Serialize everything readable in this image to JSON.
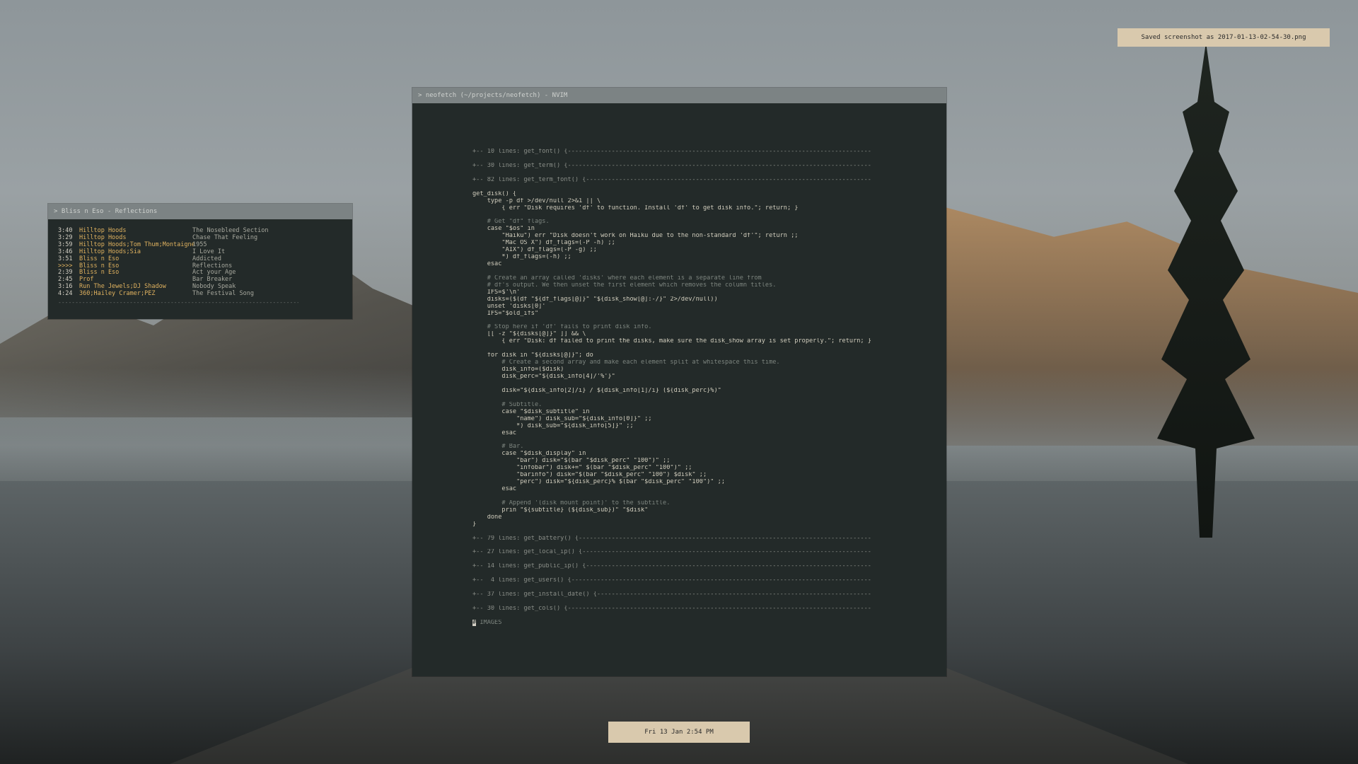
{
  "notification": {
    "text": "Saved screenshot as 2017-01-13-02-54-30.png"
  },
  "clock": {
    "text": "Fri 13 Jan  2:54 PM"
  },
  "music": {
    "title": "> Bliss n Eso - Reflections",
    "tracks": [
      {
        "time": "3:40",
        "artist": "Hilltop Hoods",
        "song": "The Nosebleed Section"
      },
      {
        "time": "3:29",
        "artist": "Hilltop Hoods",
        "song": "Chase That Feeling"
      },
      {
        "time": "3:59",
        "artist": "Hilltop Hoods;Tom Thum;Montaigne",
        "song": "1955"
      },
      {
        "time": "3:46",
        "artist": "Hilltop Hoods;Sia",
        "song": "I Love It"
      },
      {
        "time": "3:51",
        "artist": "Bliss n Eso",
        "song": "Addicted"
      },
      {
        "time": ">>>>",
        "artist": "Bliss n Eso",
        "song": "Reflections"
      },
      {
        "time": "2:39",
        "artist": "Bliss n Eso",
        "song": "Act your Age"
      },
      {
        "time": "2:45",
        "artist": "Prof",
        "song": "Bar Breaker"
      },
      {
        "time": "3:16",
        "artist": "Run The Jewels;DJ Shadow",
        "song": "Nobody Speak"
      },
      {
        "time": "4:24",
        "artist": "360;Hailey Cramer;PEZ",
        "song": "The Festival Song"
      }
    ],
    "separator": "--------------------------------------------------------------------------------"
  },
  "editor": {
    "title": "> neofetch (~/projects/neofetch) - NVIM",
    "lines": [
      {
        "text": "+-- 10 lines: get_font() {-----------------------------------------------------------------------------------",
        "cls": "fold"
      },
      {
        "text": "",
        "cls": ""
      },
      {
        "text": "+-- 30 lines: get_term() {-----------------------------------------------------------------------------------",
        "cls": "fold"
      },
      {
        "text": "",
        "cls": ""
      },
      {
        "text": "+-- 82 lines: get_term_font() {------------------------------------------------------------------------------",
        "cls": "fold"
      },
      {
        "text": "",
        "cls": ""
      },
      {
        "text": "get_disk() {",
        "cls": ""
      },
      {
        "text": "    type -p df >/dev/null 2>&1 || \\",
        "cls": ""
      },
      {
        "text": "        { err \"Disk requires 'df' to function. Install 'df' to get disk info.\"; return; }",
        "cls": ""
      },
      {
        "text": "",
        "cls": ""
      },
      {
        "text": "    # Get \"df\" flags.",
        "cls": "comment"
      },
      {
        "text": "    case \"$os\" in",
        "cls": ""
      },
      {
        "text": "        \"Haiku\") err \"Disk doesn't work on Haiku due to the non-standard 'df'\"; return ;;",
        "cls": ""
      },
      {
        "text": "        \"Mac OS X\") df_flags=(-P -h) ;;",
        "cls": ""
      },
      {
        "text": "        \"AIX\") df_flags=(-P -g) ;;",
        "cls": ""
      },
      {
        "text": "        *) df_flags=(-h) ;;",
        "cls": ""
      },
      {
        "text": "    esac",
        "cls": ""
      },
      {
        "text": "",
        "cls": ""
      },
      {
        "text": "    # Create an array called 'disks' where each element is a separate line from",
        "cls": "comment"
      },
      {
        "text": "    # df's output. We then unset the first element which removes the column titles.",
        "cls": "comment"
      },
      {
        "text": "    IFS=$'\\n'",
        "cls": ""
      },
      {
        "text": "    disks=($(df \"${df_flags[@]}\" \"${disk_show[@]:-/}\" 2>/dev/null))",
        "cls": ""
      },
      {
        "text": "    unset 'disks[0]'",
        "cls": ""
      },
      {
        "text": "    IFS=\"$old_ifs\"",
        "cls": ""
      },
      {
        "text": "",
        "cls": ""
      },
      {
        "text": "    # Stop here if 'df' fails to print disk info.",
        "cls": "comment"
      },
      {
        "text": "    [[ -z \"${disks[@]}\" ]] && \\",
        "cls": ""
      },
      {
        "text": "        { err \"Disk: df failed to print the disks, make sure the disk_show array is set properly.\"; return; }",
        "cls": ""
      },
      {
        "text": "",
        "cls": ""
      },
      {
        "text": "    for disk in \"${disks[@]}\"; do",
        "cls": ""
      },
      {
        "text": "        # Create a second array and make each element split at whitespace this time.",
        "cls": "comment"
      },
      {
        "text": "        disk_info=($disk)",
        "cls": ""
      },
      {
        "text": "        disk_perc=\"${disk_info[4]/'%'}\"",
        "cls": ""
      },
      {
        "text": "",
        "cls": ""
      },
      {
        "text": "        disk=\"${disk_info[2]/i} / ${disk_info[1]/i} (${disk_perc}%)\"",
        "cls": ""
      },
      {
        "text": "",
        "cls": ""
      },
      {
        "text": "        # Subtitle.",
        "cls": "comment"
      },
      {
        "text": "        case \"$disk_subtitle\" in",
        "cls": ""
      },
      {
        "text": "            \"name\") disk_sub=\"${disk_info[0]}\" ;;",
        "cls": ""
      },
      {
        "text": "            *) disk_sub=\"${disk_info[5]}\" ;;",
        "cls": ""
      },
      {
        "text": "        esac",
        "cls": ""
      },
      {
        "text": "",
        "cls": ""
      },
      {
        "text": "        # Bar.",
        "cls": "comment"
      },
      {
        "text": "        case \"$disk_display\" in",
        "cls": ""
      },
      {
        "text": "            \"bar\") disk=\"$(bar \"$disk_perc\" \"100\")\" ;;",
        "cls": ""
      },
      {
        "text": "            \"infobar\") disk+=\" $(bar \"$disk_perc\" \"100\")\" ;;",
        "cls": ""
      },
      {
        "text": "            \"barinfo\") disk=\"$(bar \"$disk_perc\" \"100\") $disk\" ;;",
        "cls": ""
      },
      {
        "text": "            \"perc\") disk=\"${disk_perc}% $(bar \"$disk_perc\" \"100\")\" ;;",
        "cls": ""
      },
      {
        "text": "        esac",
        "cls": ""
      },
      {
        "text": "",
        "cls": ""
      },
      {
        "text": "        # Append '(disk mount point)' to the subtitle.",
        "cls": "comment"
      },
      {
        "text": "        prin \"${subtitle} (${disk_sub})\" \"$disk\"",
        "cls": ""
      },
      {
        "text": "    done",
        "cls": ""
      },
      {
        "text": "}",
        "cls": ""
      },
      {
        "text": "",
        "cls": ""
      },
      {
        "text": "+-- 79 lines: get_battery() {--------------------------------------------------------------------------------",
        "cls": "fold"
      },
      {
        "text": "",
        "cls": ""
      },
      {
        "text": "+-- 27 lines: get_local_ip() {-------------------------------------------------------------------------------",
        "cls": "fold"
      },
      {
        "text": "",
        "cls": ""
      },
      {
        "text": "+-- 14 lines: get_public_ip() {------------------------------------------------------------------------------",
        "cls": "fold"
      },
      {
        "text": "",
        "cls": ""
      },
      {
        "text": "+--  4 lines: get_users() {----------------------------------------------------------------------------------",
        "cls": "fold"
      },
      {
        "text": "",
        "cls": ""
      },
      {
        "text": "+-- 37 lines: get_install_date() {---------------------------------------------------------------------------",
        "cls": "fold"
      },
      {
        "text": "",
        "cls": ""
      },
      {
        "text": "+-- 30 lines: get_cols() {-----------------------------------------------------------------------------------",
        "cls": "fold"
      },
      {
        "text": "",
        "cls": ""
      },
      {
        "text": "# IMAGES",
        "cls": "comment cursorline"
      }
    ]
  }
}
